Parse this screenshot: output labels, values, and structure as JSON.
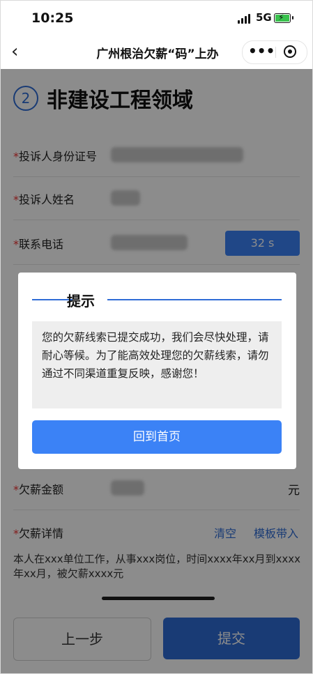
{
  "status_bar": {
    "time": "10:25",
    "network": "5G"
  },
  "nav": {
    "back_icon": "‹",
    "title": "广州根治欠薪“码”上办",
    "more_icon": "•••"
  },
  "section": {
    "step_number": "2",
    "title": "非建设工程领域"
  },
  "form": {
    "required_mark": "*",
    "id_label": "投诉人身份证号",
    "name_label": "投诉人姓名",
    "phone_label": "联系电话",
    "sms_countdown": "32 s",
    "amount_label": "欠薪金额",
    "amount_unit": "元",
    "detail_label": "欠薪详情",
    "clear_link": "清空",
    "template_link": "模板带入",
    "detail_text": "本人在xxx单位工作，从事xxx岗位，时间xxxx年xx月到xxxx年xx月，被欠薪xxxx元"
  },
  "footer": {
    "prev_label": "上一步",
    "submit_label": "提交"
  },
  "dialog": {
    "title": "提示",
    "message": "您的欠薪线索已提交成功，我们会尽快处理，请耐心等候。为了能高效处理您的欠薪线索，请勿通过不同渠道重复反映，感谢您！",
    "button_label": "回到首页"
  },
  "colors": {
    "primary": "#2f6cd6",
    "button_blue": "#3b82f6",
    "required_red": "#e33333"
  }
}
